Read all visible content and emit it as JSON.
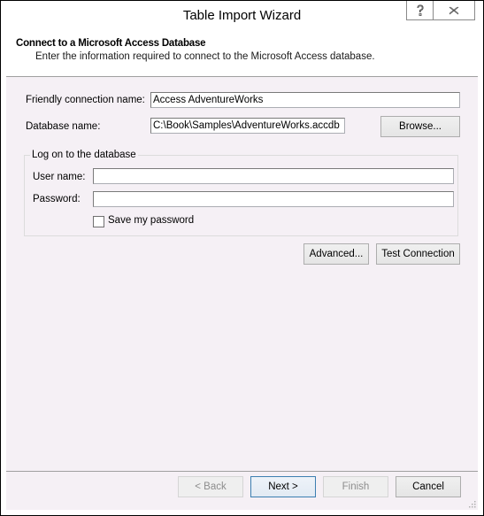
{
  "window": {
    "title": "Table Import Wizard",
    "help_icon": "help-icon",
    "close_icon": "close-icon"
  },
  "header": {
    "title": "Connect to a Microsoft Access Database",
    "subtitle": "Enter the information required to connect to the Microsoft Access database."
  },
  "form": {
    "friendly_name_label": "Friendly connection name:",
    "friendly_name_value": "Access AdventureWorks",
    "database_label": "Database name:",
    "database_value": "C:\\Book\\Samples\\AdventureWorks.accdb",
    "browse_label": "Browse..."
  },
  "logon": {
    "legend": "Log on to the database",
    "username_label": "User name:",
    "username_value": "",
    "password_label": "Password:",
    "password_value": "",
    "save_password_label": "Save my password",
    "save_password_checked": false
  },
  "actions": {
    "advanced_label": "Advanced...",
    "test_connection_label": "Test Connection"
  },
  "footer": {
    "back_label": "< Back",
    "back_enabled": false,
    "next_label": "Next >",
    "next_enabled": true,
    "finish_label": "Finish",
    "finish_enabled": false,
    "cancel_label": "Cancel",
    "cancel_enabled": true
  }
}
